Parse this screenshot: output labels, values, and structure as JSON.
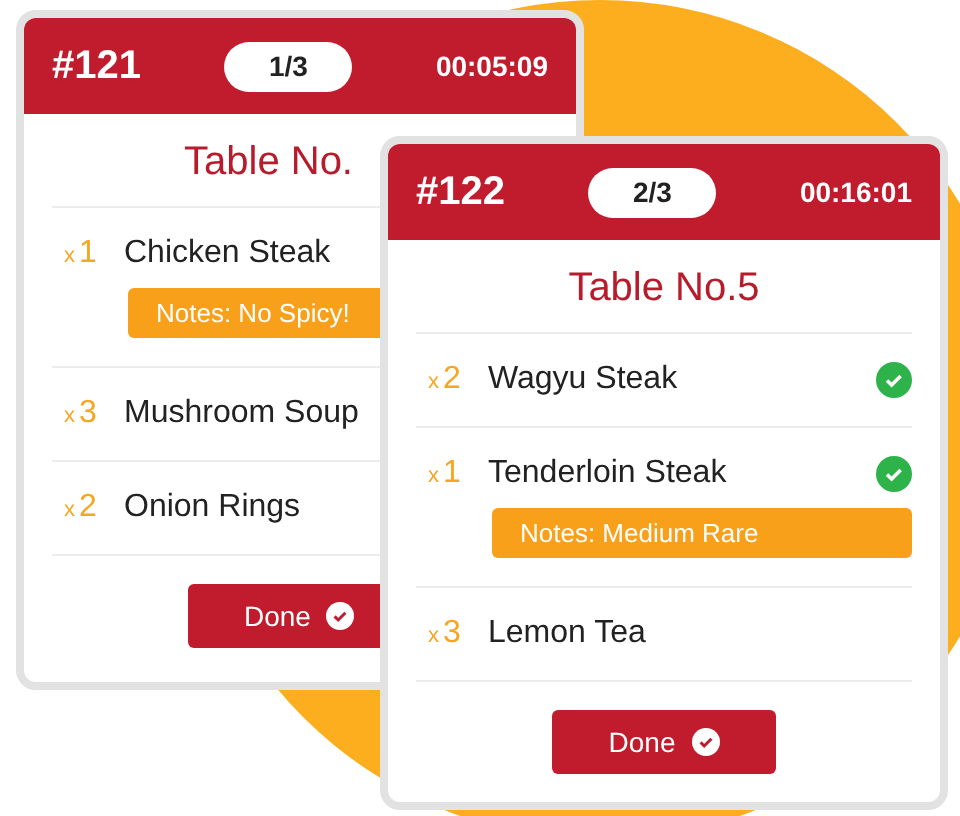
{
  "tickets": [
    {
      "number": "#121",
      "position": "1/3",
      "elapsed": "00:05:09",
      "table": "Table No.",
      "items": [
        {
          "times": "x",
          "qty": "1",
          "name": "Chicken Steak",
          "notes": "Notes: No Spicy!"
        },
        {
          "times": "x",
          "qty": "3",
          "name": "Mushroom Soup"
        },
        {
          "times": "x",
          "qty": "2",
          "name": "Onion Rings"
        }
      ],
      "button": "Done"
    },
    {
      "number": "#122",
      "position": "2/3",
      "elapsed": "00:16:01",
      "table": "Table No.5",
      "items": [
        {
          "times": "x",
          "qty": "2",
          "name": "Wagyu Steak",
          "done": true
        },
        {
          "times": "x",
          "qty": "1",
          "name": "Tenderloin Steak",
          "done": true,
          "notes": "Notes: Medium Rare"
        },
        {
          "times": "x",
          "qty": "3",
          "name": "Lemon Tea",
          "done": false
        }
      ],
      "button": "Done"
    }
  ]
}
